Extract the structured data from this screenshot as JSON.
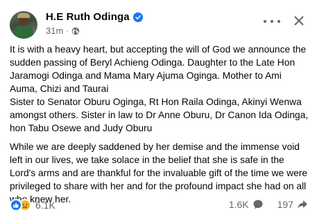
{
  "post": {
    "author": "H.E Ruth Odinga",
    "time": "31m",
    "separator": "·",
    "audience_icon": "globe-icon",
    "verified_icon": "verified-badge-icon",
    "paragraphs": [
      "It is with a heavy heart, but accepting the will of God we announce the sudden passing of Beryl Achieng Odinga. Daughter to the Late Hon Jaramogi Odinga and Mama Mary Ajuma Oginga. Mother to Ami Auma, Chizi and Taurai\nSister to  Senator Oburu Oginga,  Rt Hon Raila Odinga, Akinyi Wenwa amongst others. Sister in law to Dr Anne Oburu,  Dr Canon Ida Odinga, hon Tabu Osewe and Judy Oburu",
      "While we are deeply saddened by her demise and the immense void left in our lives, we take solace in the belief that she is safe in the Lord's arms and are thankful for the invaluable gift of the time we were privileged to share with her and for the profound impact she had on all who knew her."
    ],
    "reactions": {
      "icons": [
        "like-icon",
        "sad-icon"
      ],
      "count": "6.1K"
    },
    "comments_count": "1.6K",
    "shares_count": "197"
  },
  "colors": {
    "accent": "#1877f2",
    "secondary_text": "#65676b",
    "sad_reaction": "#f7b125"
  }
}
